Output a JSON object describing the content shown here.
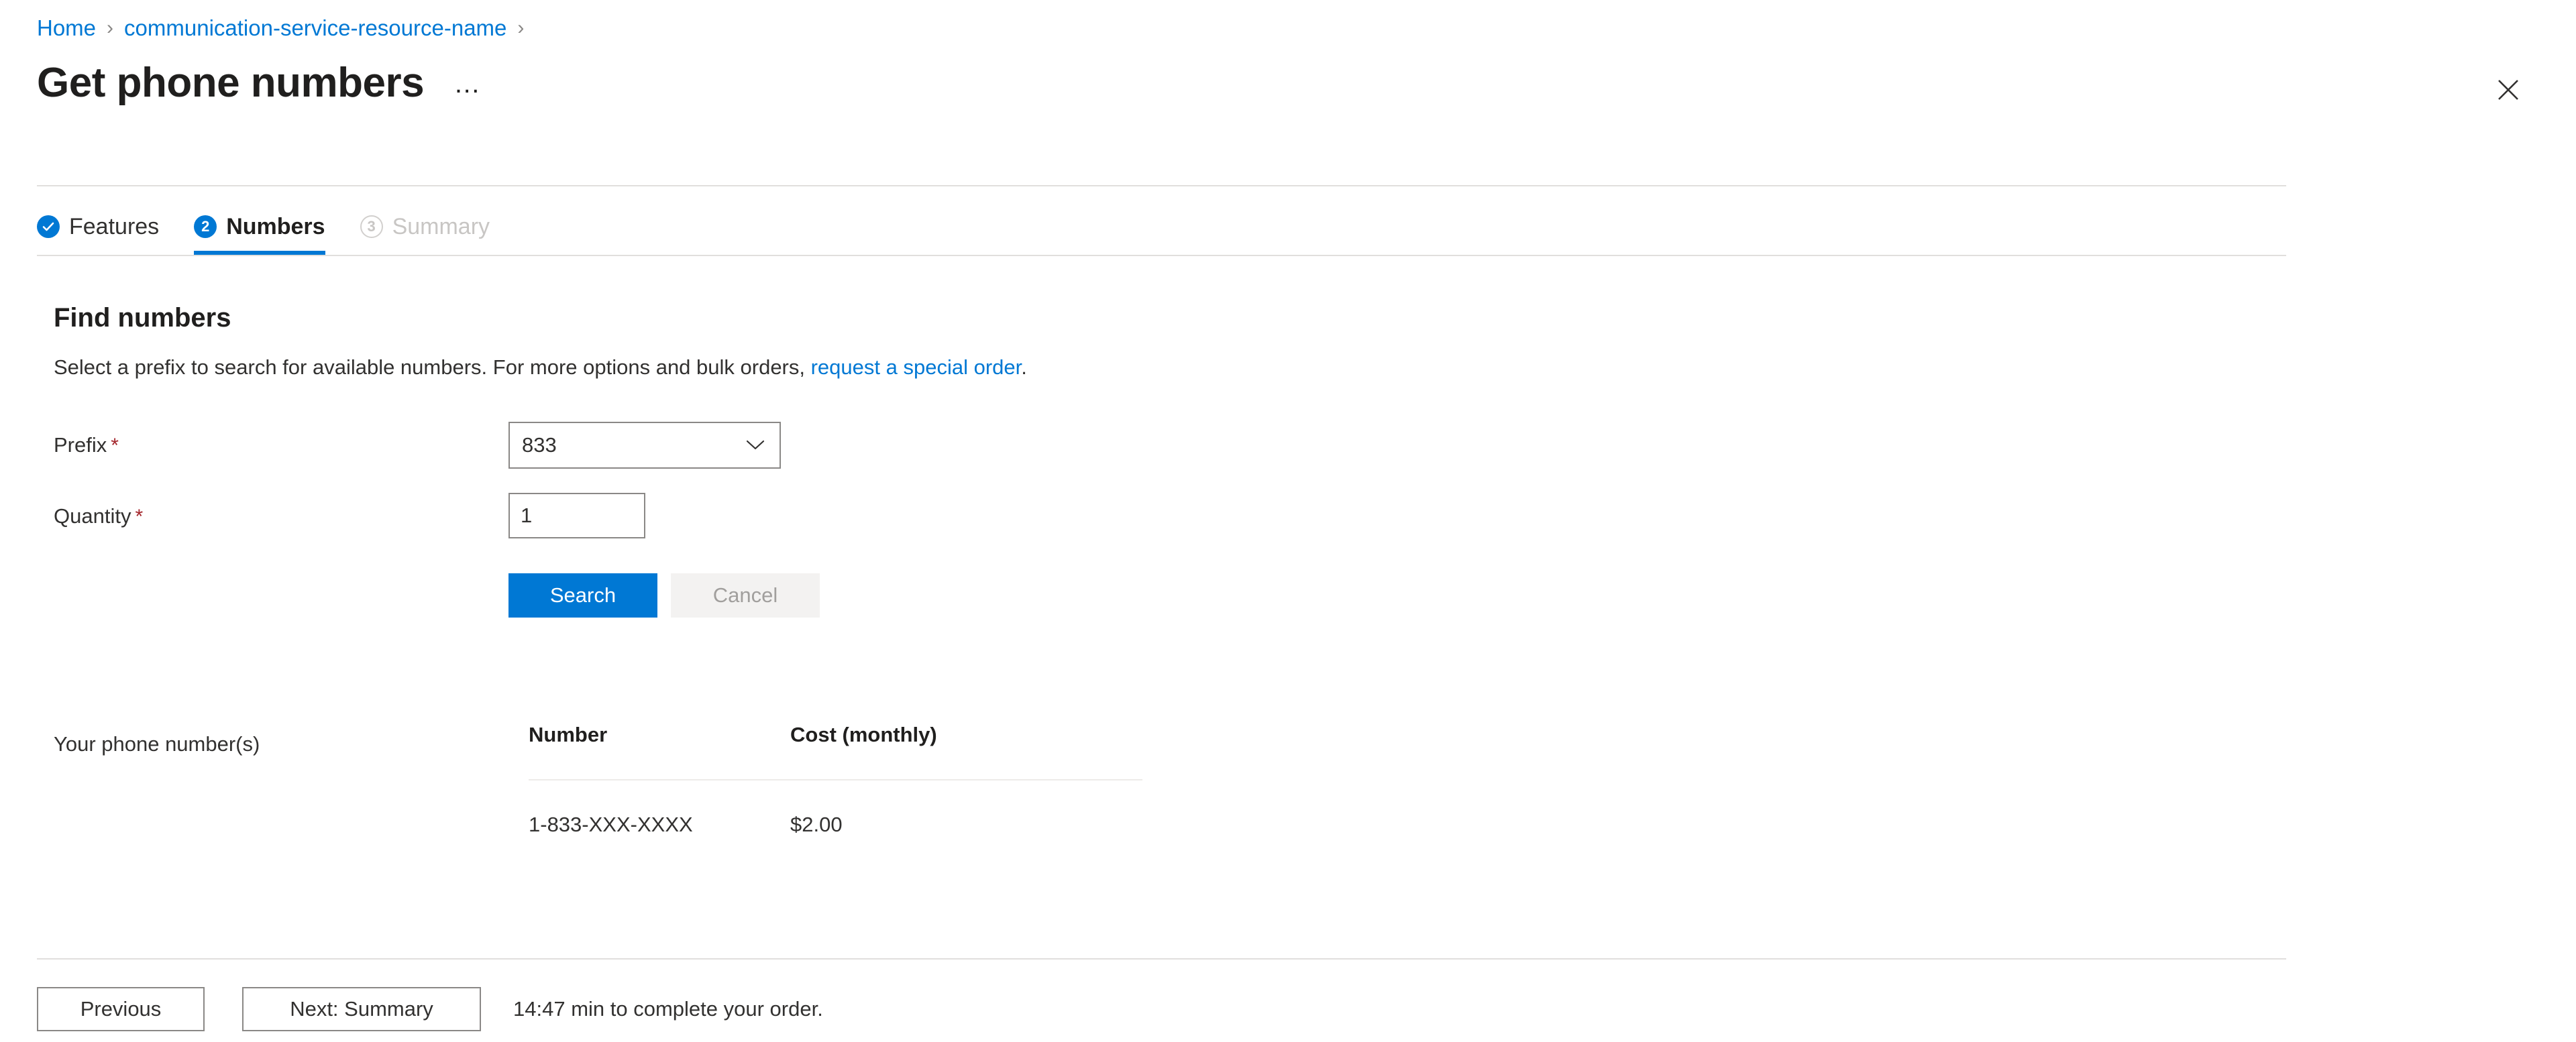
{
  "breadcrumb": {
    "items": [
      {
        "label": "Home"
      },
      {
        "label": "communication-service-resource-name"
      }
    ],
    "separator": "›"
  },
  "header": {
    "title": "Get phone numbers",
    "ellipsis": "…",
    "close_icon": "close-icon"
  },
  "tabs": [
    {
      "label": "Features",
      "marker": "✓",
      "state": "done"
    },
    {
      "label": "Numbers",
      "marker": "2",
      "state": "current"
    },
    {
      "label": "Summary",
      "marker": "3",
      "state": "pending"
    }
  ],
  "section": {
    "title": "Find numbers",
    "description_before": "Select a prefix to search for available numbers. For more options and bulk orders, ",
    "description_link": "request a special order",
    "description_after": "."
  },
  "form": {
    "prefix": {
      "label": "Prefix",
      "required_mark": "*",
      "value": "833",
      "chevron_icon": "chevron-down-icon"
    },
    "quantity": {
      "label": "Quantity",
      "required_mark": "*",
      "value": "1",
      "placeholder": ""
    },
    "search_label": "Search",
    "cancel_label": "Cancel"
  },
  "results": {
    "label": "Your phone number(s)",
    "columns": [
      "Number",
      "Cost (monthly)"
    ],
    "rows": [
      {
        "number": "1-833-XXX-XXXX",
        "cost": "$2.00"
      }
    ]
  },
  "footer": {
    "previous_label": "Previous",
    "next_label": "Next: Summary",
    "note": "14:47 min to complete your order."
  },
  "colors": {
    "accent": "#0078d4",
    "required": "#a4262c",
    "divider": "#e1dfdd",
    "disabled_text": "#a19f9d"
  }
}
